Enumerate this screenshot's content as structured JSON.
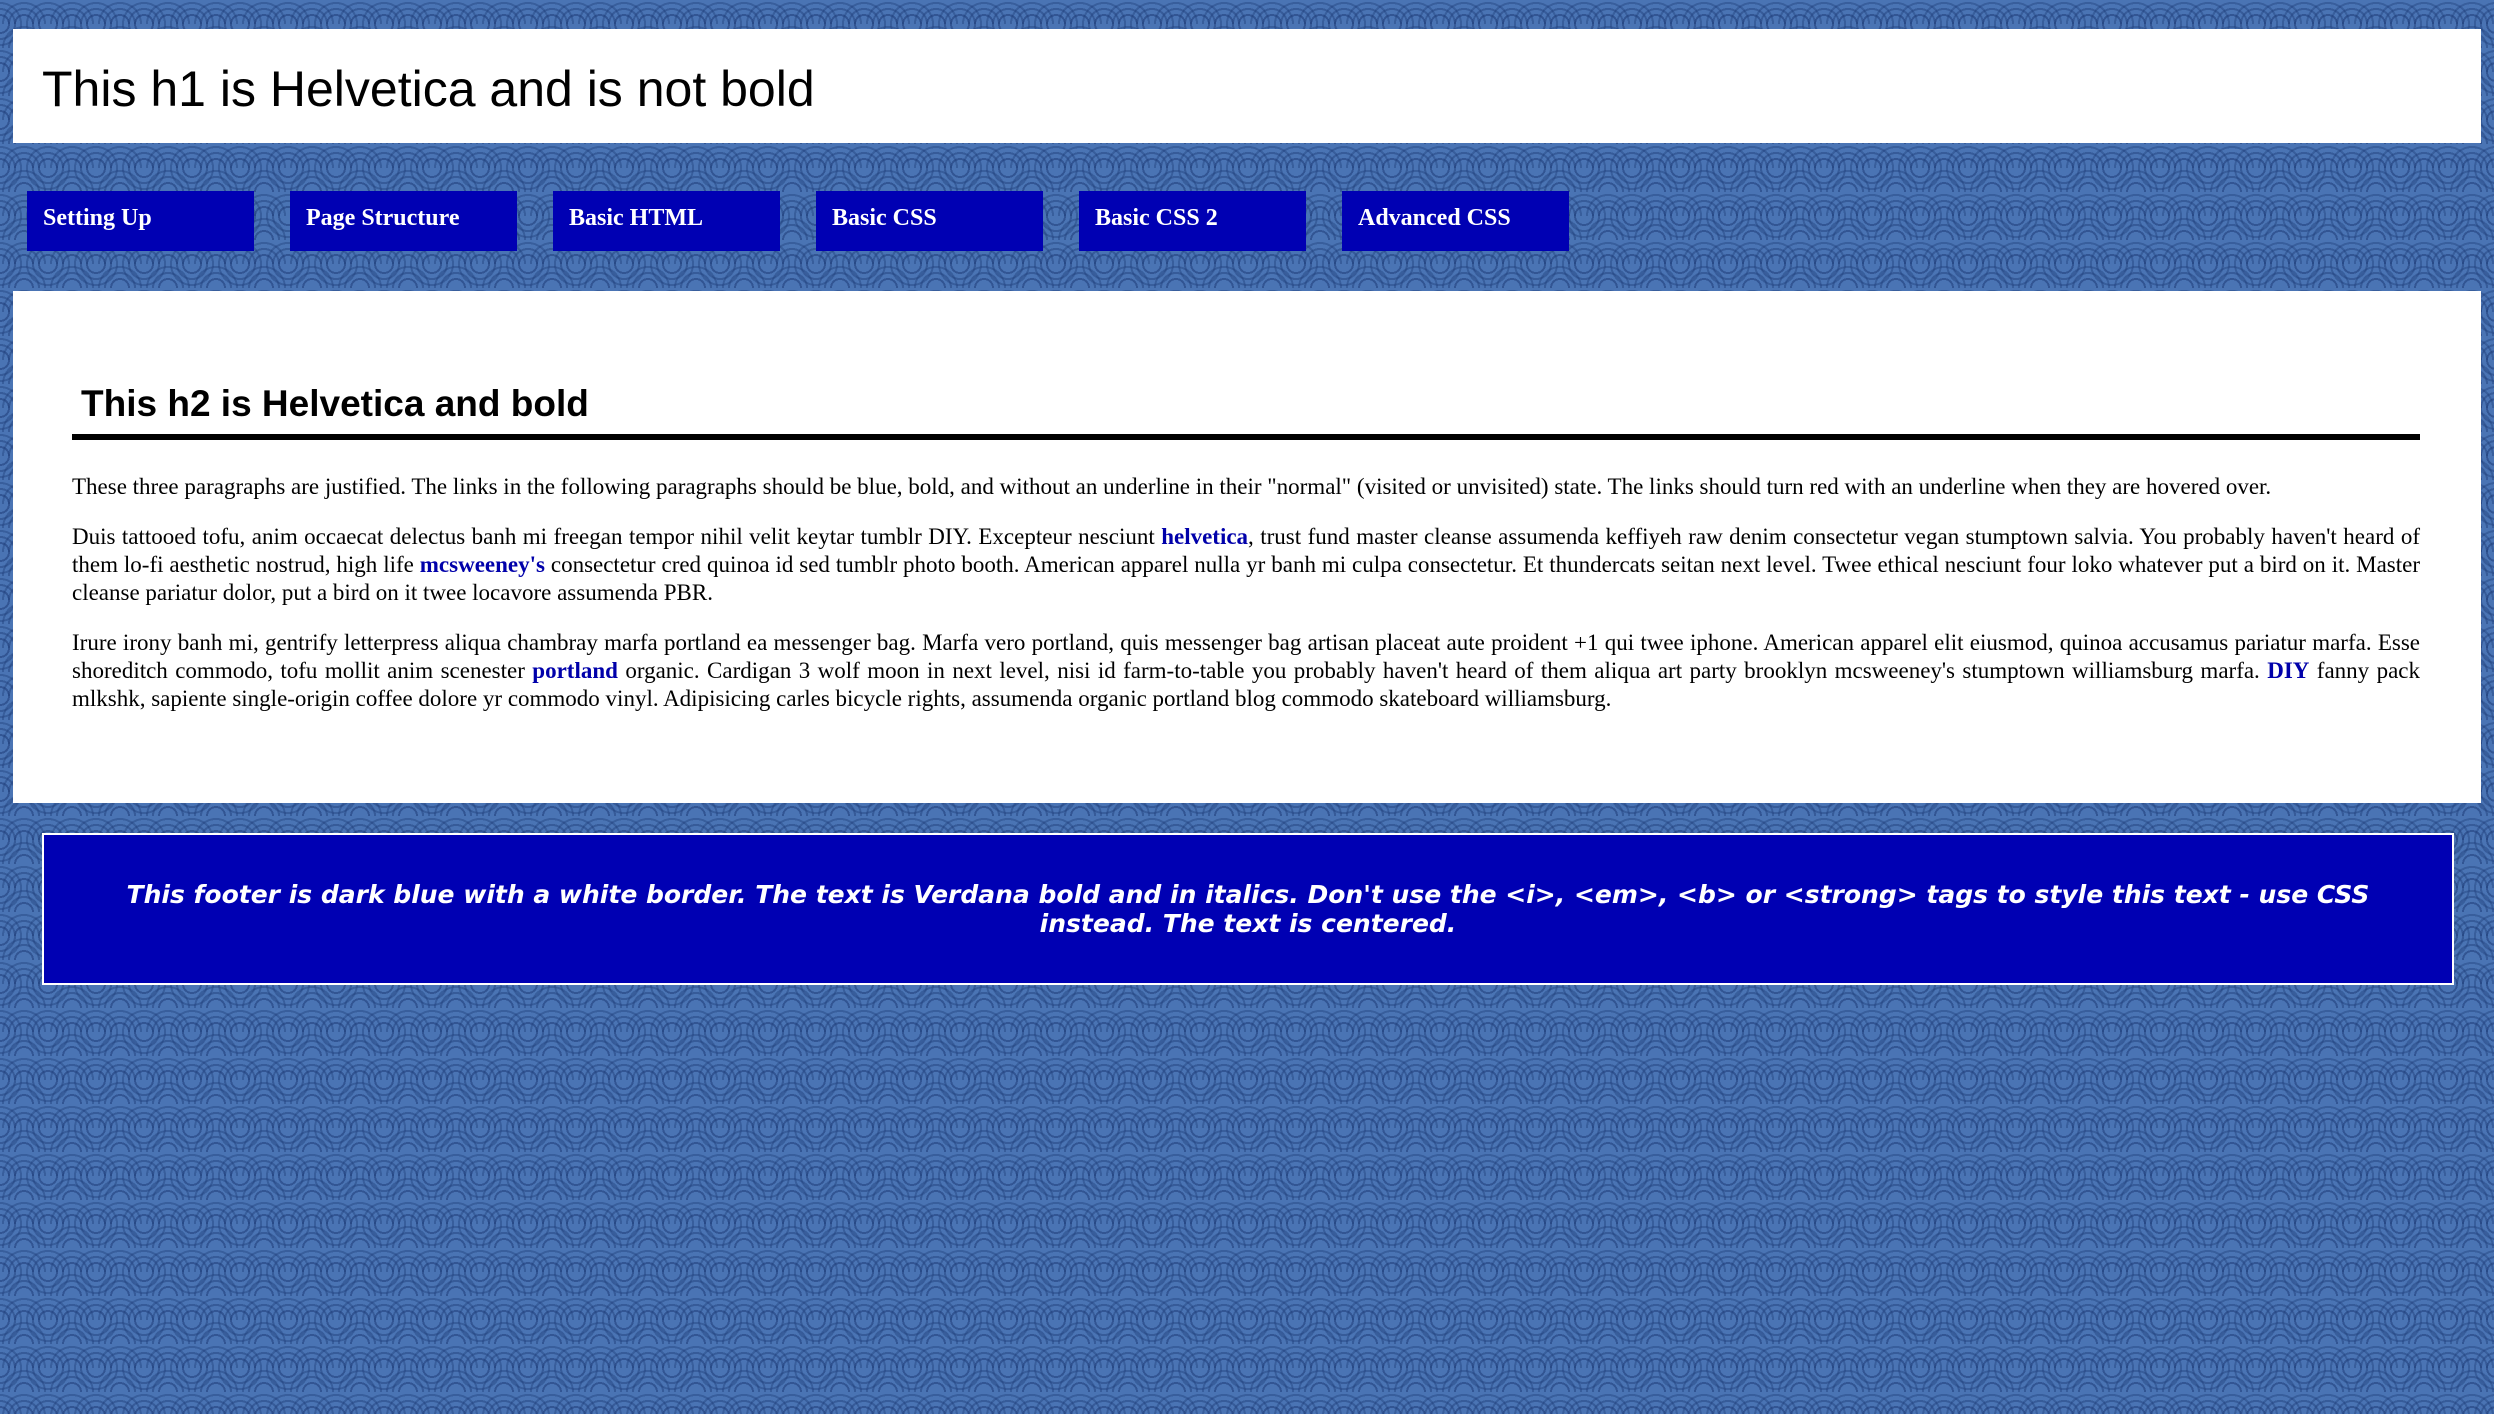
{
  "header": {
    "title": "This h1 is Helvetica and is not bold"
  },
  "nav": {
    "items": [
      {
        "label": "Setting Up"
      },
      {
        "label": "Page Structure"
      },
      {
        "label": "Basic HTML"
      },
      {
        "label": "Basic CSS"
      },
      {
        "label": "Basic CSS 2"
      },
      {
        "label": "Advanced CSS"
      }
    ]
  },
  "main": {
    "heading": "This h2 is Helvetica and bold",
    "p1": "These three paragraphs are justified. The links in the following paragraphs should be blue, bold, and without an underline in their \"normal\" (visited or unvisited) state. The links should turn red with an underline when they are hovered over.",
    "p2": {
      "t1": "Duis tattooed tofu, anim occaecat delectus banh mi freegan tempor nihil velit keytar tumblr DIY. Excepteur nesciunt ",
      "link1": "helvetica",
      "t2": ", trust fund master cleanse assumenda keffiyeh raw denim consectetur vegan stumptown salvia. You probably haven't heard of them lo-fi aesthetic nostrud, high life ",
      "link2": "mcsweeney's",
      "t3": " consectetur cred quinoa id sed tumblr photo booth. American apparel nulla yr banh mi culpa consectetur. Et thundercats seitan next level. Twee ethical nesciunt four loko whatever put a bird on it. Master cleanse pariatur dolor, put a bird on it twee locavore assumenda PBR."
    },
    "p3": {
      "t1": "Irure irony banh mi, gentrify letterpress aliqua chambray marfa portland ea messenger bag. Marfa vero portland, quis messenger bag artisan placeat aute proident +1 qui twee iphone. American apparel elit eiusmod, quinoa accusamus pariatur marfa. Esse shoreditch commodo, tofu mollit anim scenester ",
      "link1": "portland",
      "t2": " organic. Cardigan 3 wolf moon in next level, nisi id farm-to-table you probably haven't heard of them aliqua art party brooklyn mcsweeney's stumptown williamsburg marfa. ",
      "link2": "DIY",
      "t3": " fanny pack mlkshk, sapiente single-origin coffee dolore yr commodo vinyl. Adipisicing carles bicycle rights, assumenda organic portland blog commodo skateboard williamsburg."
    }
  },
  "footer": {
    "text": "This footer is dark blue with a white border. The text is Verdana bold and in italics. Don't use the <i>, <em>, <b> or <strong> tags to style this text - use CSS instead. The text is centered."
  },
  "colors": {
    "background": "#4a74b4",
    "nav_bg": "#0000b3",
    "link": "#0000aa",
    "link_hover": "#ff0000",
    "footer_bg": "#0000b3"
  }
}
